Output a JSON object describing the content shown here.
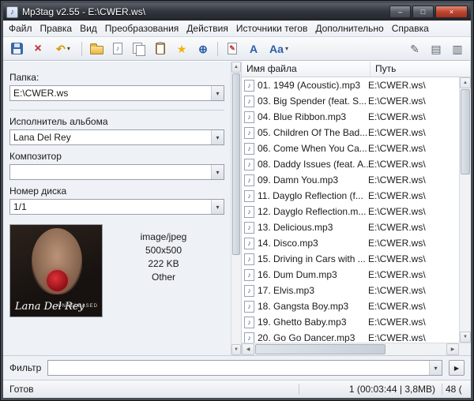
{
  "window": {
    "title": "Mp3tag v2.55  -  E:\\CWER.ws\\",
    "icon_glyph": "♪"
  },
  "ui": {
    "dropdown": "▾",
    "up": "▲",
    "down": "▼",
    "left": "◀",
    "right": "▶",
    "min": "–",
    "max": "□",
    "close": "×"
  },
  "menu": {
    "items": [
      "Файл",
      "Правка",
      "Вид",
      "Преобразования",
      "Действия",
      "Источники тегов",
      "Дополнительно",
      "Справка"
    ]
  },
  "toolbar": {
    "glyphs": {
      "remove": "×",
      "undo": "↶",
      "note": "♪",
      "star": "★",
      "web": "⊕",
      "pencil": "✎",
      "a": "A",
      "aa": "Aa",
      "list": "▤",
      "cols": "▥"
    }
  },
  "tag_panel": {
    "folder_label": "Папка:",
    "folder_value": "E:\\CWER.ws",
    "album_artist_label": "Исполнитель альбома",
    "album_artist_value": "Lana Del Rey",
    "composer_label": "Композитор",
    "composer_value": "",
    "disc_label": "Номер диска",
    "disc_value": "1/1",
    "cover": {
      "info": [
        "image/jpeg",
        "500x500",
        "222 KB",
        "Other"
      ],
      "script_text": "Lana Del Rey",
      "subtitle": "UNRELEASED"
    }
  },
  "file_list": {
    "columns": [
      "Имя файла",
      "Путь"
    ],
    "row_icon": "♪",
    "rows": [
      {
        "name": "01. 1949 (Acoustic).mp3",
        "path": "E:\\CWER.ws\\"
      },
      {
        "name": "03. Big Spender (feat. S...",
        "path": "E:\\CWER.ws\\"
      },
      {
        "name": "04. Blue Ribbon.mp3",
        "path": "E:\\CWER.ws\\"
      },
      {
        "name": "05. Children Of The Bad...",
        "path": "E:\\CWER.ws\\"
      },
      {
        "name": "06. Come When You Ca...",
        "path": "E:\\CWER.ws\\"
      },
      {
        "name": "08. Daddy Issues (feat. A...",
        "path": "E:\\CWER.ws\\"
      },
      {
        "name": "09. Damn You.mp3",
        "path": "E:\\CWER.ws\\"
      },
      {
        "name": "11. Dayglo Reflection (f...",
        "path": "E:\\CWER.ws\\"
      },
      {
        "name": "12. Dayglo Reflection.m...",
        "path": "E:\\CWER.ws\\"
      },
      {
        "name": "13. Delicious.mp3",
        "path": "E:\\CWER.ws\\"
      },
      {
        "name": "14. Disco.mp3",
        "path": "E:\\CWER.ws\\"
      },
      {
        "name": "15. Driving in Cars with ...",
        "path": "E:\\CWER.ws\\"
      },
      {
        "name": "16. Dum Dum.mp3",
        "path": "E:\\CWER.ws\\"
      },
      {
        "name": "17. Elvis.mp3",
        "path": "E:\\CWER.ws\\"
      },
      {
        "name": "18. Gangsta Boy.mp3",
        "path": "E:\\CWER.ws\\"
      },
      {
        "name": "19. Ghetto Baby.mp3",
        "path": "E:\\CWER.ws\\"
      },
      {
        "name": "20. Go Go Dancer.mp3",
        "path": "E:\\CWER.ws\\"
      }
    ]
  },
  "filter": {
    "label": "Фильтр",
    "value": ""
  },
  "status": {
    "ready": "Готов",
    "selection": "1 (00:03:44 | 3,8MB)",
    "count": "48 ("
  }
}
